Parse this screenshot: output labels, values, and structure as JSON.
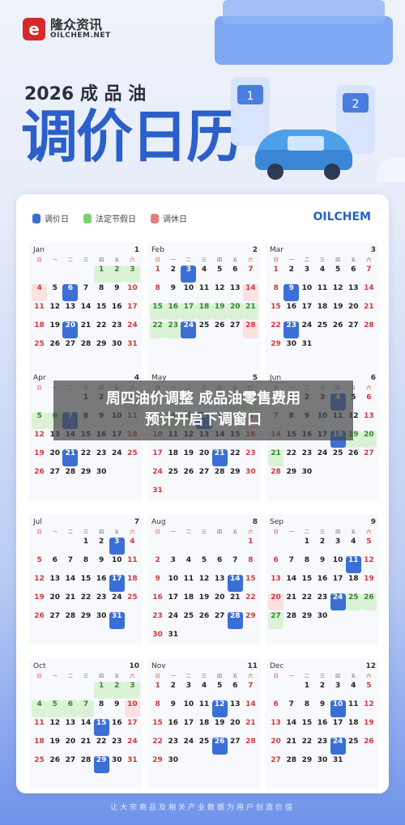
{
  "header": {
    "logo_text": "隆众资讯",
    "logo_sub": "OILCHEM.NET",
    "year_line": "2026 成 品 油",
    "title": "调价日历"
  },
  "legend": {
    "adjust": "调价日",
    "holiday": "法定节假日",
    "rest": "调休日",
    "brand": "OILCHEM",
    "colors": {
      "adjust": "#3b6fd6",
      "holiday": "#7fcf6f",
      "rest": "#e57d7d"
    }
  },
  "weekdays": [
    "日",
    "一",
    "二",
    "三",
    "四",
    "五",
    "六"
  ],
  "months": [
    {
      "name": "Jan",
      "num": "1",
      "start": 4,
      "days": 31,
      "adjust": [
        6,
        20
      ],
      "holiday": [
        1,
        2,
        3
      ],
      "rest": [
        4
      ]
    },
    {
      "name": "Feb",
      "num": "2",
      "start": 0,
      "days": 28,
      "adjust": [
        3,
        24
      ],
      "holiday": [
        15,
        16,
        17,
        18,
        19,
        20,
        21,
        22,
        23
      ],
      "rest": [
        14,
        28
      ]
    },
    {
      "name": "Mar",
      "num": "3",
      "start": 0,
      "days": 31,
      "adjust": [
        9,
        23
      ],
      "holiday": [],
      "rest": []
    },
    {
      "name": "Apr",
      "num": "4",
      "start": 3,
      "days": 30,
      "adjust": [
        7,
        21
      ],
      "holiday": [
        4,
        5,
        6
      ],
      "rest": []
    },
    {
      "name": "May",
      "num": "5",
      "start": 5,
      "days": 31,
      "adjust": [
        6,
        21
      ],
      "holiday": [
        1,
        2,
        3,
        4,
        5
      ],
      "rest": [
        9
      ]
    },
    {
      "name": "Jun",
      "num": "6",
      "start": 1,
      "days": 30,
      "adjust": [
        4,
        18
      ],
      "holiday": [
        19,
        20,
        21
      ],
      "rest": []
    },
    {
      "name": "Jul",
      "num": "7",
      "start": 3,
      "days": 31,
      "adjust": [
        3,
        17,
        31
      ],
      "holiday": [],
      "rest": []
    },
    {
      "name": "Aug",
      "num": "8",
      "start": 6,
      "days": 31,
      "adjust": [
        14,
        28
      ],
      "holiday": [],
      "rest": []
    },
    {
      "name": "Sep",
      "num": "9",
      "start": 2,
      "days": 30,
      "adjust": [
        11,
        24
      ],
      "holiday": [
        25,
        26,
        27
      ],
      "rest": [
        20
      ]
    },
    {
      "name": "Oct",
      "num": "10",
      "start": 4,
      "days": 31,
      "adjust": [
        15,
        29
      ],
      "holiday": [
        1,
        2,
        3,
        4,
        5,
        6,
        7
      ],
      "rest": [
        10
      ]
    },
    {
      "name": "Nov",
      "num": "11",
      "start": 0,
      "days": 30,
      "adjust": [
        12,
        26
      ],
      "holiday": [],
      "rest": []
    },
    {
      "name": "Dec",
      "num": "12",
      "start": 2,
      "days": 31,
      "adjust": [
        10,
        24
      ],
      "holiday": [],
      "rest": []
    }
  ],
  "banner": {
    "line1": "周四油价调整 成品油零售费用",
    "line2": "预计开启下调窗口"
  },
  "footer": "让大宗商品及相关产业数据为用户创造价值"
}
